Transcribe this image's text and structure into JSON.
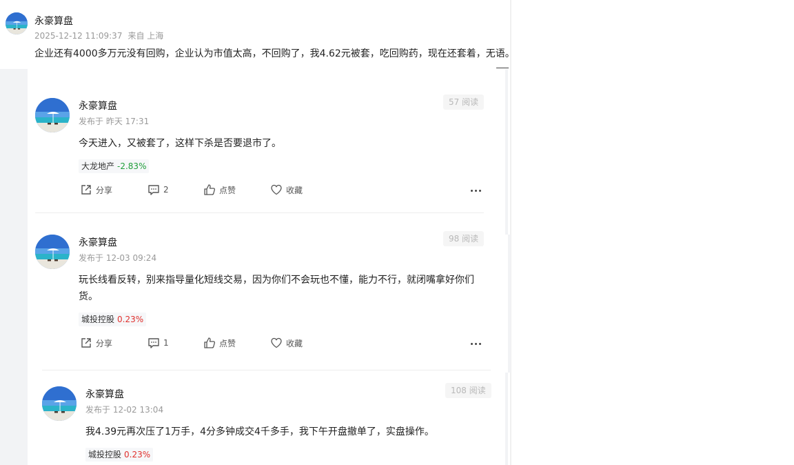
{
  "main_post": {
    "author": "永豪算盘",
    "time": "2025-12-12 11:09:37",
    "source": "来自 上海",
    "content": "企业还有4000多万元没有回购，企业认为市值太高，不回购了，我4.62元被套，吃回购药，现在还套着，无语。"
  },
  "actions": {
    "share": "分享",
    "like": "点赞",
    "favorite": "收藏"
  },
  "posts": [
    {
      "author": "永豪算盘",
      "time": "发布于 昨天 17:31",
      "views": "57 阅读",
      "content": "今天进入，又被套了，这样下杀是否要退市了。",
      "stock_name": "大龙地产",
      "stock_change": "-2.83%",
      "comments": "2"
    },
    {
      "author": "永豪算盘",
      "time": "发布于 12-03 09:24",
      "views": "98 阅读",
      "content": "玩长线看反转，别来指导量化短线交易，因为你们不会玩也不懂，能力不行，就闭嘴拿好你们货。",
      "stock_name": "城投控股",
      "stock_change": "0.23%",
      "comments": "1"
    },
    {
      "author": "永豪算盘",
      "time": "发布于 12-02 13:04",
      "views": "108 阅读",
      "content": "我4.39元再次压了1万手，4分多钟成交4千多手，我下午开盘撤单了，实盘操作。",
      "stock_name": "城投控股",
      "stock_change": "0.23%"
    }
  ],
  "colors": {
    "down": "#1f9d3a",
    "up": "#e0302d",
    "page_bg": "#f2f3f5"
  }
}
